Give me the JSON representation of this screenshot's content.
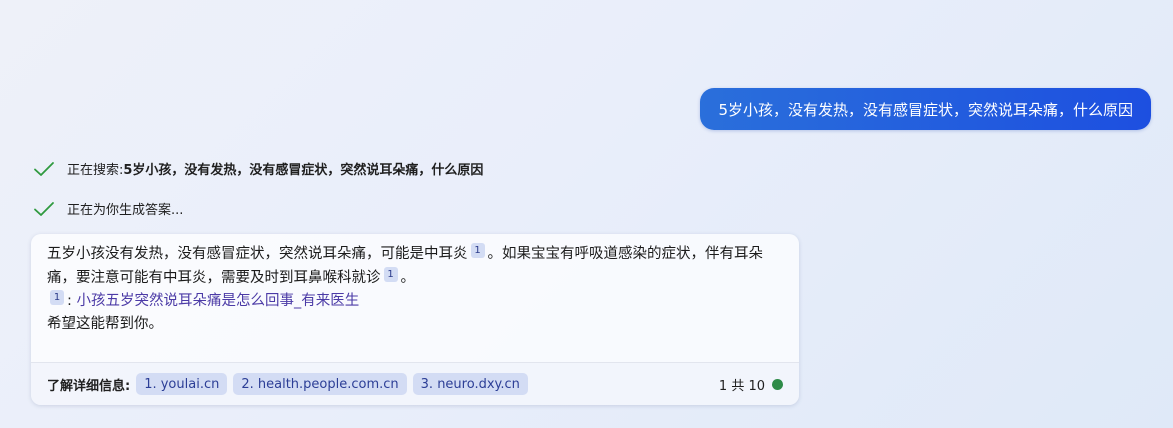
{
  "user_message": "5岁小孩，没有发热，没有感冒症状，突然说耳朵痛，什么原因",
  "status": {
    "searching_prefix": "正在搜索: ",
    "searching_query": "5岁小孩，没有发热，没有感冒症状，突然说耳朵痛，什么原因",
    "generating": "正在为你生成答案..."
  },
  "answer": {
    "paragraph_part1": "五岁小孩没有发热，没有感冒症状，突然说耳朵痛，可能是中耳炎",
    "citation_1": "1",
    "paragraph_part2": "。如果宝宝有呼吸道感染的症状，伴有耳朵痛，要注意可能有中耳炎，需要及时到耳鼻喉科就诊",
    "citation_2": "1",
    "paragraph_part3": "。",
    "reference": {
      "number": "1",
      "separator": ":",
      "title": "小孩五岁突然说耳朵痛是怎么回事_有来医生"
    },
    "closing": "希望这能帮到你。"
  },
  "footer": {
    "learn_more_label": "了解详细信息:",
    "sources": [
      "1. youlai.cn",
      "2. health.people.com.cn",
      "3. neuro.dxy.cn"
    ],
    "page_count": "1 共 10",
    "status_color": "#2e8b48"
  },
  "colors": {
    "accent": "#1d4fe0",
    "check": "#2f9a3f",
    "link": "#4b3aa6",
    "chip_bg": "#d3dcf4"
  }
}
